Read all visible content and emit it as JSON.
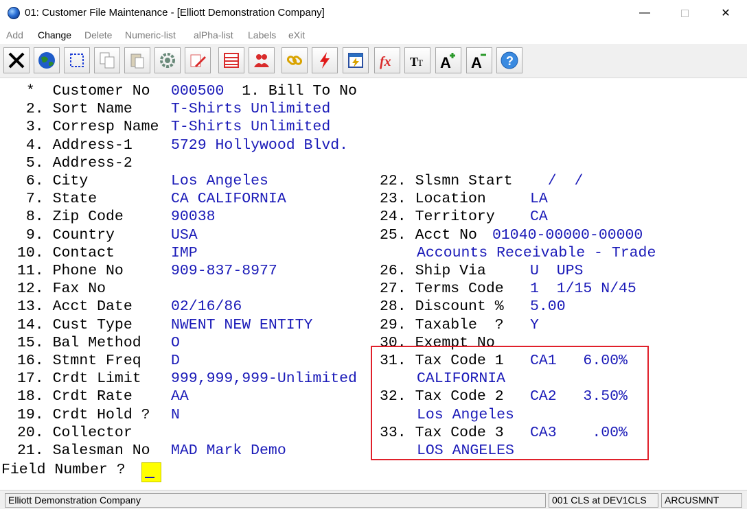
{
  "window": {
    "title": "01: Customer File Maintenance - [Elliott Demonstration Company]",
    "minimize": "—",
    "close": "✕"
  },
  "menu": [
    {
      "label": "Add",
      "active": false
    },
    {
      "label": "Change",
      "active": true
    },
    {
      "label": "Delete",
      "active": false
    },
    {
      "label": "Numeric-list",
      "active": false
    },
    {
      "label": "alPha-list",
      "active": false
    },
    {
      "label": "Labels",
      "active": false
    },
    {
      "label": "eXit",
      "active": false
    }
  ],
  "toolbar": [
    "close-x-icon",
    "globe-icon",
    "select-box-icon",
    "copy-icon",
    "paste-icon",
    "settings-gear-icon",
    "edit-pencil-icon",
    "table-icon",
    "users-icon",
    "link-icon",
    "lightning-icon",
    "calculator-icon",
    "fx-icon",
    "font-size-icon",
    "font-increase-icon",
    "font-decrease-icon",
    "help-icon"
  ],
  "form": {
    "left": [
      {
        "label": " *  Customer No",
        "value": "000500  1. Bill To No"
      },
      {
        "label": " 2. Sort Name",
        "value": "T-Shirts Unlimited"
      },
      {
        "label": " 3. Corresp Name",
        "value": "T-Shirts Unlimited"
      },
      {
        "label": " 4. Address-1",
        "value": "5729 Hollywood Blvd."
      },
      {
        "label": " 5. Address-2",
        "value": ""
      },
      {
        "label": " 6. City",
        "value": "Los Angeles"
      },
      {
        "label": " 7. State",
        "value": "CA CALIFORNIA"
      },
      {
        "label": " 8. Zip Code",
        "value": "90038"
      },
      {
        "label": " 9. Country",
        "value": "USA"
      },
      {
        "label": "10. Contact",
        "value": "IMP"
      },
      {
        "label": "11. Phone No",
        "value": "909-837-8977"
      },
      {
        "label": "12. Fax No",
        "value": ""
      },
      {
        "label": "13. Acct Date",
        "value": "02/16/86"
      },
      {
        "label": "14. Cust Type",
        "value": "NWENT NEW ENTITY"
      },
      {
        "label": "15. Bal Method",
        "value": "O"
      },
      {
        "label": "16. Stmnt Freq",
        "value": "D"
      },
      {
        "label": "17. Crdt Limit",
        "value": "999,999,999-Unlimited"
      },
      {
        "label": "18. Crdt Rate",
        "value": "AA"
      },
      {
        "label": "19. Crdt Hold ?",
        "value": "N"
      },
      {
        "label": "20. Collector",
        "value": ""
      },
      {
        "label": "21. Salesman No",
        "value": "MAD Mark Demo"
      }
    ],
    "right": [
      {
        "label": "22. Slsmn Start",
        "value": "  /  /"
      },
      {
        "label": "23. Location",
        "value": "LA"
      },
      {
        "label": "24. Territory",
        "value": "CA"
      },
      {
        "label": "25. Acct No",
        "value": "01040-00000-00000"
      },
      {
        "label": "",
        "value": "Accounts Receivable - Trade"
      },
      {
        "label": "26. Ship Via",
        "value": "U  UPS"
      },
      {
        "label": "27. Terms Code",
        "value": "1  1/15 N/45"
      },
      {
        "label": "28. Discount %",
        "value": "5.00"
      },
      {
        "label": "29. Taxable  ?",
        "value": "Y"
      },
      {
        "label": "30. Exempt No",
        "value": ""
      },
      {
        "label": "31. Tax Code 1",
        "value": "CA1   6.00%"
      },
      {
        "label": "",
        "value": "CALIFORNIA"
      },
      {
        "label": "32. Tax Code 2",
        "value": "CA2   3.50%"
      },
      {
        "label": "",
        "value": "Los Angeles"
      },
      {
        "label": "33. Tax Code 3",
        "value": "CA3    .00%"
      },
      {
        "label": "",
        "value": "LOS ANGELES"
      }
    ],
    "prompt": "Field Number ?"
  },
  "status": {
    "company": "Elliott Demonstration Company",
    "session": "001 CLS at DEV1CLS",
    "program": "ARCUSMNT"
  },
  "colors": {
    "label": "#000000",
    "value": "#1a1ab8",
    "highlight": "#e0202a",
    "cursor": "#ffff00"
  }
}
